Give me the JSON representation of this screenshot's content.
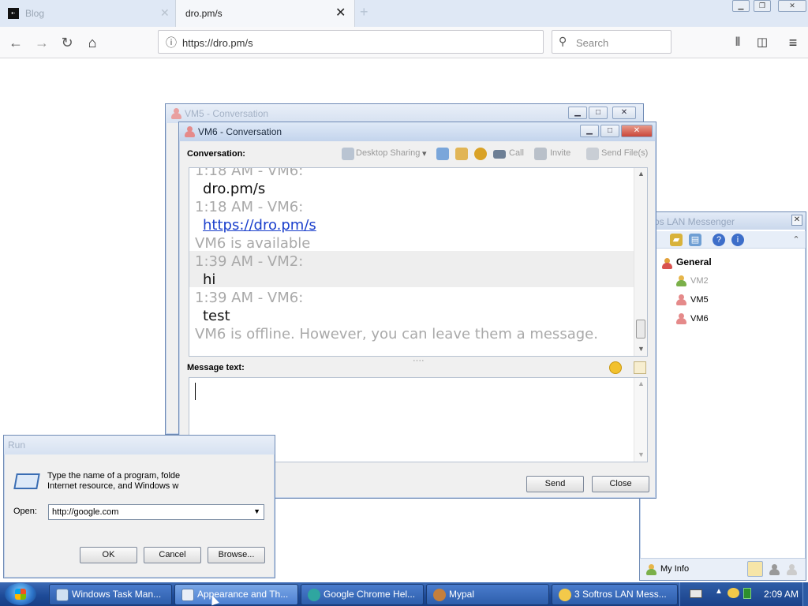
{
  "browser": {
    "tab_inactive_label": "Blog",
    "tab_active_label": "dro.pm/s",
    "url": "https://dro.pm/s",
    "search_placeholder": "Search"
  },
  "vm5_window": {
    "title": "VM5 - Conversation"
  },
  "contacts_window": {
    "title": "os LAN Messenger",
    "group": "General",
    "contacts": [
      "VM2",
      "VM5",
      "VM6"
    ],
    "footer_label": "My Info"
  },
  "conversation_window": {
    "title": "VM6 - Conversation",
    "conversation_label": "Conversation:",
    "toolbar": {
      "desktop_sharing": "Desktop Sharing",
      "call": "Call",
      "invite": "Invite",
      "send_files": "Send File(s)"
    },
    "lines": [
      {
        "kind": "meta",
        "text": "1:18 AM - VM6:"
      },
      {
        "kind": "msg",
        "text": "dro.pm/s"
      },
      {
        "kind": "meta",
        "text": "1:18 AM - VM6:"
      },
      {
        "kind": "link",
        "text": "https://dro.pm/s"
      },
      {
        "kind": "meta",
        "text": "VM6 is available"
      },
      {
        "kind": "meta",
        "text": "1:39 AM - VM2:"
      },
      {
        "kind": "msg",
        "text": "hi"
      },
      {
        "kind": "meta",
        "text": "1:39 AM - VM6:"
      },
      {
        "kind": "msg",
        "text": "test"
      },
      {
        "kind": "meta",
        "text": "VM6 is offline. However, you can leave them a message."
      }
    ],
    "message_label": "Message text:",
    "send_button": "Send",
    "close_button": "Close"
  },
  "run_dialog": {
    "title": "Run",
    "description_line1": "Type the name of a program, folde",
    "description_line2": "Internet resource, and Windows w",
    "open_label": "Open:",
    "open_value": "http://google.com",
    "ok_button": "OK",
    "cancel_button": "Cancel",
    "browse_button": "Browse..."
  },
  "taskbar": {
    "items": [
      "Windows Task Man...",
      "Appearance and Th...",
      "Google Chrome Hel...",
      "Mypal",
      "3 Softros LAN Mess..."
    ],
    "clock": "2:09 AM"
  }
}
